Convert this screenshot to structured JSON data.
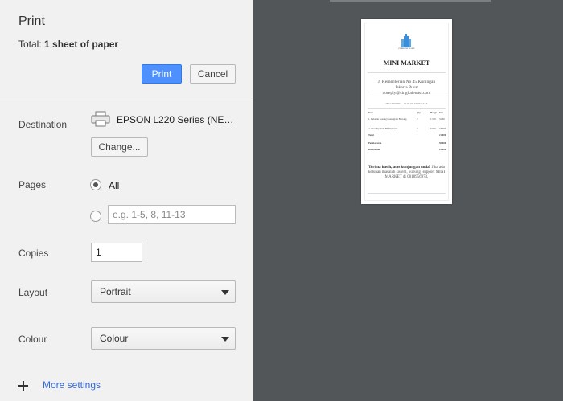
{
  "header": {
    "title": "Print",
    "total_label": "Total:",
    "total_value": "1 sheet of paper",
    "print_button": "Print",
    "cancel_button": "Cancel"
  },
  "destination": {
    "label": "Destination",
    "printer_name": "EPSON L220 Series (NE…",
    "change_button": "Change..."
  },
  "pages": {
    "label": "Pages",
    "all_label": "All",
    "custom_placeholder": "e.g. 1-5, 8, 11-13",
    "selected": "All"
  },
  "copies": {
    "label": "Copies",
    "value": "1"
  },
  "layout": {
    "label": "Layout",
    "value": "Portrait"
  },
  "colour": {
    "label": "Colour",
    "value": "Colour"
  },
  "more_settings": {
    "label": "More settings"
  },
  "preview": {
    "logo_text": "COMPANY NAME",
    "store_name": "MINI MARKET",
    "address_line1": "Jl Kementerian No 45 Kuningan",
    "address_line2": "Jakarta Pusat",
    "email": "noreply@singhaleuasi.com",
    "invoice_line": "INV-0000001 - 2018-07-27 05:14:16",
    "table_header": {
      "item": "Item",
      "qty": "Qty",
      "price": "Harga",
      "subtotal": "Sub"
    },
    "items": [
      {
        "name": "1. Indomie Goreng Rasa Ayam Bawang",
        "qty": "2",
        "price": "1.500",
        "subtotal": "3.000"
      },
      {
        "name": "2. Obat Nyamuk Hit Elecktrik",
        "qty": "2",
        "price": "9.000",
        "subtotal": "18.000"
      }
    ],
    "total_label": "Total",
    "total_value": "21.000",
    "payment_label": "Pembayaran",
    "payment_value": "50.000",
    "change_label": "Kembalian",
    "change_value": "29.000",
    "thanks_bold": "Terima kasih, atas kunjungan anda!",
    "thanks_rest": "Jika ada keluhan masalah sistem, hubungi support MINI MARKET di 0818956973."
  },
  "colors": {
    "print_button_bg": "#4d90fe",
    "preview_bg": "#525659",
    "sidebar_bg": "#f1f1f1",
    "link": "#3367d6"
  }
}
